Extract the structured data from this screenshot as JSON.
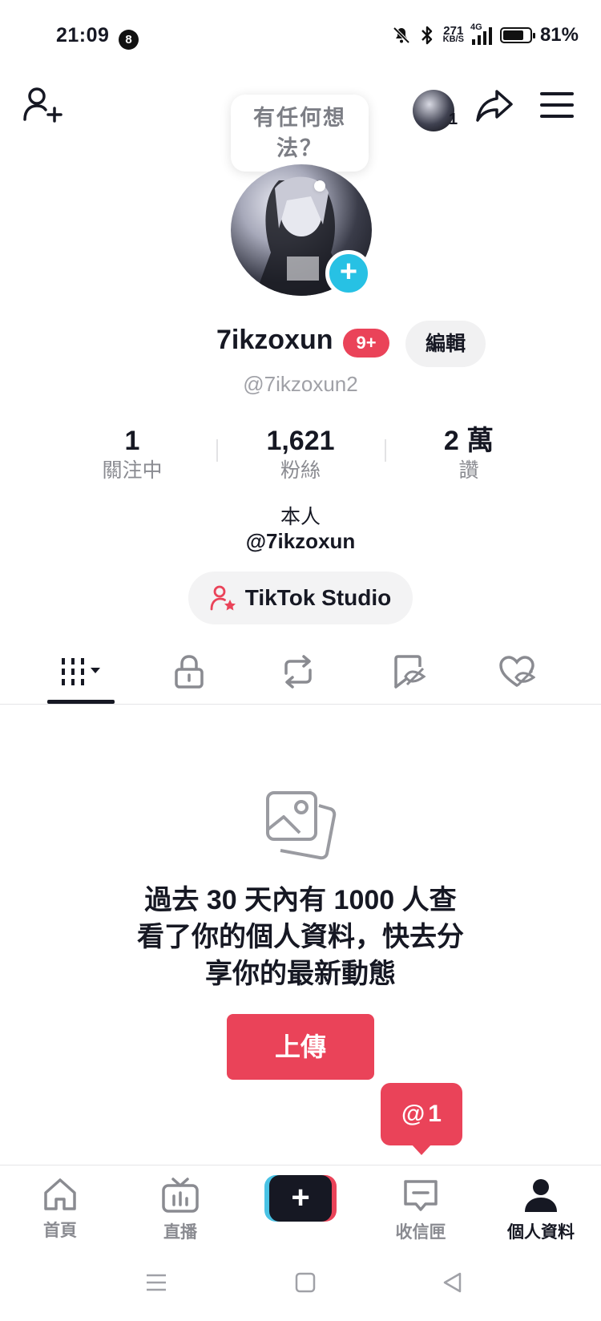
{
  "status_bar": {
    "time": "21:09",
    "notification_count": "8",
    "net_speed_value": "271",
    "net_speed_unit": "KB/S",
    "network": "4G",
    "battery": "81%",
    "battery_level": 0.81
  },
  "header": {
    "tooltip_line1": "有任何想",
    "tooltip_line2": "法？",
    "mini_avatar_count": "1"
  },
  "profile": {
    "username": "7ikzoxun",
    "badge": "9+",
    "edit_label": "編輯",
    "handle": "@7ikzoxun2"
  },
  "stats": [
    {
      "value": "1",
      "label": "關注中"
    },
    {
      "value": "1,621",
      "label": "粉絲"
    },
    {
      "value": "2 萬",
      "label": "讚"
    }
  ],
  "bio": {
    "line1": "本人",
    "line2": "@7ikzoxun"
  },
  "studio_button": "TikTok Studio",
  "tabs": [
    {
      "icon": "grid-videos-icon",
      "active": true
    },
    {
      "icon": "lock-icon"
    },
    {
      "icon": "repost-icon"
    },
    {
      "icon": "favorites-icon"
    },
    {
      "icon": "liked-icon"
    }
  ],
  "empty_state": {
    "icon": "image-gallery-icon",
    "line1": "過去 30 天內有 1000 人查",
    "line2": "看了你的個人資料，快去分",
    "line3": "享你的最新動態",
    "upload_label": "上傳"
  },
  "mention_bubble": {
    "symbol": "@",
    "count": "1"
  },
  "bottom_nav": [
    {
      "label": "首頁",
      "icon": "home-icon"
    },
    {
      "label": "直播",
      "icon": "live-tv-icon"
    },
    {
      "label": "",
      "icon": "plus-icon"
    },
    {
      "label": "收信匣",
      "icon": "inbox-icon"
    },
    {
      "label": "個人資料",
      "icon": "profile-icon",
      "active": true
    }
  ],
  "colors": {
    "accent": "#EA4359",
    "avatar_add": "#27C1E4",
    "text_primary": "#161823",
    "text_secondary": "#8A8B91"
  }
}
